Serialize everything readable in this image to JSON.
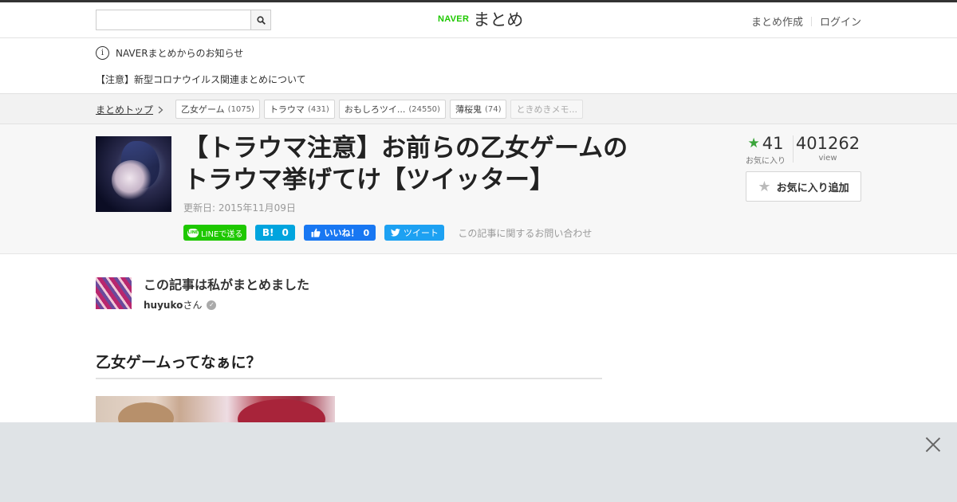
{
  "header": {
    "search": {
      "placeholder": "",
      "value": ""
    },
    "logo_brand": "NAVER",
    "logo_text": "まとめ",
    "links": [
      "まとめ作成",
      "ログイン"
    ]
  },
  "notice": {
    "title": "NAVERまとめからのお知らせ",
    "item": "【注意】新型コロナウイルス関連まとめについて"
  },
  "breadcrumb": {
    "top_label": "まとめトップ",
    "tags": [
      {
        "label": "乙女ゲーム",
        "count": "(1075)"
      },
      {
        "label": "トラウマ",
        "count": "(431)"
      },
      {
        "label": "おもしろツイ...",
        "count": "(24550)"
      },
      {
        "label": "薄桜鬼",
        "count": "(74)"
      },
      {
        "label": "ときめきメモ...",
        "count": ""
      }
    ]
  },
  "article": {
    "title_line1": "【トラウマ注意】お前らの乙女ゲームの",
    "title_line2": "トラウマ挙げてけ【ツイッター】",
    "updated": "更新日: 2015年11月09日",
    "share": {
      "line_label": "LINEで送る",
      "line_icon": "LINE",
      "hatena_icon": "B!",
      "hatena_count": "0",
      "fb_label": "いいね！",
      "fb_count": "0",
      "tweet_label": "ツイート"
    },
    "contact_label": "この記事に関するお問い合わせ",
    "favorites_count": "41",
    "favorites_label": "お気に入り",
    "views_count": "401262",
    "views_label": "view",
    "fav_button_label": "お気に入り追加"
  },
  "author": {
    "heading": "この記事は私がまとめました",
    "name": "huyuko",
    "suffix": "さん"
  },
  "section": {
    "title": "乙女ゲームってなぁに？"
  },
  "colors": {
    "naver_green": "#1ec800",
    "hatena_blue": "#00a4de",
    "facebook_blue": "#1877f2",
    "twitter_blue": "#1da1f2",
    "fav_star_green": "#3aa53a"
  }
}
